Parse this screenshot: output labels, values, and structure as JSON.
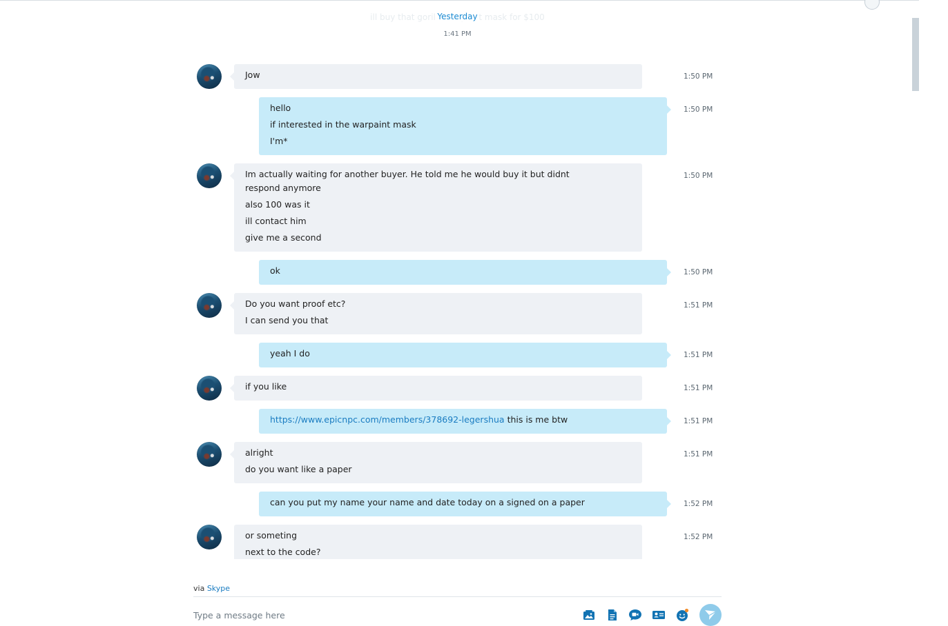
{
  "header": {
    "faded_preview": "ill buy that gorilla warpaint mask for $100",
    "date_label": "Yesterday",
    "date_time": "1:41 PM"
  },
  "messages": [
    {
      "direction": "incoming",
      "lines": [
        "Jow"
      ],
      "time": "1:50 PM"
    },
    {
      "direction": "outgoing",
      "lines": [
        "hello",
        "if interested in the warpaint mask",
        "I'm*"
      ],
      "time": "1:50 PM"
    },
    {
      "direction": "incoming",
      "lines": [
        "Im actually waiting for another buyer. He told me he would buy it but didnt respond anymore",
        "also 100 was it",
        "ill contact him",
        "give me a second"
      ],
      "time": "1:50 PM"
    },
    {
      "direction": "outgoing",
      "lines": [
        "ok"
      ],
      "time": "1:50 PM"
    },
    {
      "direction": "incoming",
      "lines": [
        "Do you want proof etc?",
        "I can send you that"
      ],
      "time": "1:51 PM"
    },
    {
      "direction": "outgoing",
      "lines": [
        "yeah I do"
      ],
      "time": "1:51 PM"
    },
    {
      "direction": "incoming",
      "lines": [
        "if you like"
      ],
      "time": "1:51 PM"
    },
    {
      "direction": "outgoing",
      "link": "https://www.epicnpc.com/members/378692-legershua",
      "after_link": " this is me btw",
      "time": "1:51 PM"
    },
    {
      "direction": "incoming",
      "lines": [
        "alright",
        "do you want like a paper"
      ],
      "time": "1:51 PM"
    },
    {
      "direction": "outgoing",
      "lines": [
        "can you put my name your name and date today on a signed on a paper"
      ],
      "time": "1:52 PM"
    },
    {
      "direction": "incoming",
      "lines": [
        "or someting",
        "next to the code?"
      ],
      "time": "1:52 PM"
    }
  ],
  "footer": {
    "via_prefix": "via ",
    "via_app": "Skype",
    "compose_placeholder": "Type a message here",
    "tools": [
      "media-gallery-icon",
      "file-icon",
      "video-message-icon",
      "contact-card-icon",
      "emoticon-icon",
      "send-icon"
    ]
  },
  "colors": {
    "incoming_bubble": "#eef1f5",
    "outgoing_bubble": "#c7ebf9",
    "accent": "#1a7cc1",
    "send_button": "#8fcbea"
  }
}
